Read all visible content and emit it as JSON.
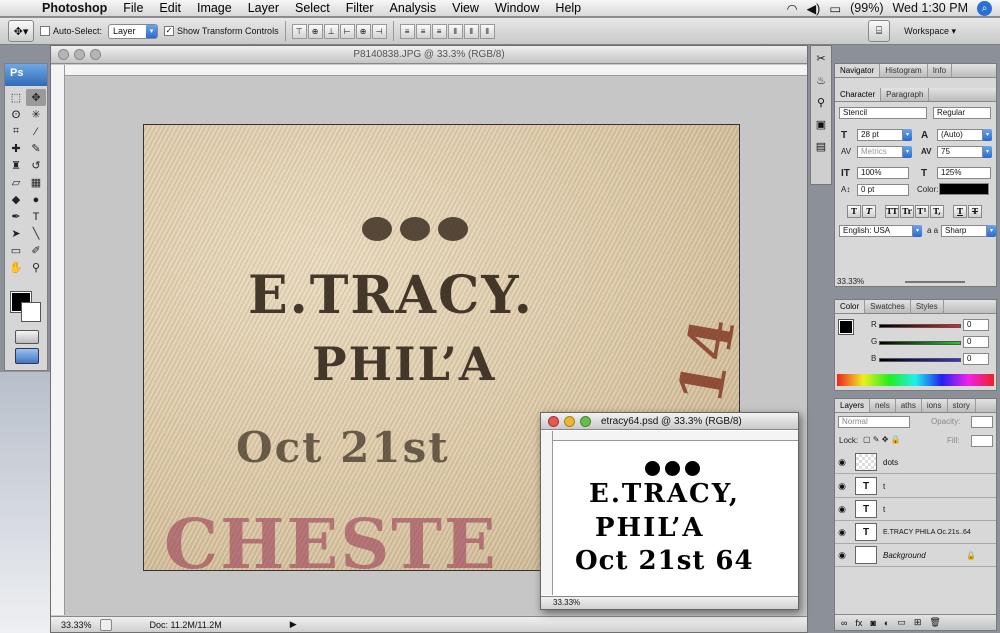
{
  "menubar": {
    "app": "Photoshop",
    "items": [
      "File",
      "Edit",
      "Image",
      "Layer",
      "Select",
      "Filter",
      "Analysis",
      "View",
      "Window",
      "Help"
    ],
    "battery": "(99%)",
    "clock": "Wed 1:30 PM"
  },
  "options": {
    "auto_select_label": "Auto-Select:",
    "auto_select_value": "Layer",
    "show_transform": "Show Transform Controls",
    "workspace": "Workspace"
  },
  "tools": {
    "logo": "Ps"
  },
  "main_doc": {
    "title": "P8140838.JPG @ 33.3% (RGB/8)",
    "zoom": "33.33%",
    "doc_size": "Doc: 11.2M/11.2M"
  },
  "doc2": {
    "title": "etracy64.psd @ 33.3% (RGB/8)",
    "line1": "E.TRACY,",
    "line2": "PHIL’A",
    "line3": "Oct 21st 64",
    "zoom": "33.33%"
  },
  "panels": {
    "nav_tabs": [
      "Navigator",
      "Histogram",
      "Info"
    ],
    "char_tabs": [
      "Character",
      "Paragraph"
    ],
    "font_family": "Stencil",
    "font_style": "Regular",
    "font_size": "28 pt",
    "leading": "(Auto)",
    "kerning": "Metrics",
    "tracking": "75",
    "vscale": "100%",
    "hscale": "125%",
    "baseline": "0 pt",
    "color_label": "Color:",
    "language": "English: USA",
    "aa_label": "a a",
    "antialias": "Sharp",
    "type_buttons": [
      "T",
      "T",
      "TT",
      "Tr",
      "T¹",
      "T,",
      "T",
      "T"
    ],
    "nav_zoom": "33.33%",
    "color_tabs": [
      "Color",
      "Swatches",
      "Styles"
    ],
    "rgb_labels": [
      "R",
      "G",
      "B"
    ],
    "rgb_values": [
      "0",
      "0",
      "0"
    ],
    "layers_tabs": [
      "Layers",
      "nels",
      "aths",
      "ions",
      "story"
    ],
    "blend": "Normal",
    "opacity_label": "Opacity:",
    "fill_label": "Fill:",
    "lock_label": "Lock:",
    "layers": [
      "dots",
      "t",
      "t",
      "E.TRACY PHILA Oc.21s..64",
      "Background"
    ]
  }
}
